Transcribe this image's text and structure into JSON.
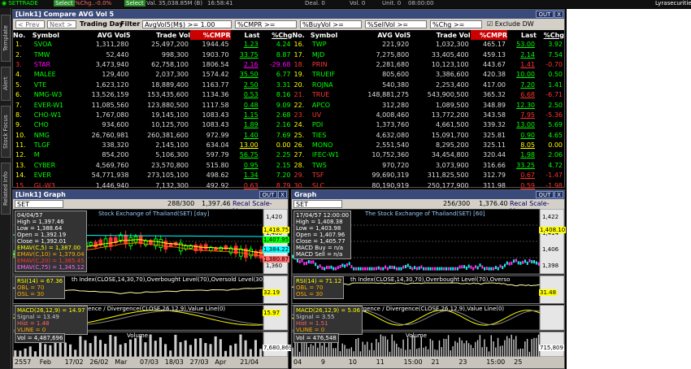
{
  "topbar": {
    "a": "Select",
    "b": "%Chg..-0.0%",
    "c": "Select",
    "d": "Val. 35,038.85M (B)",
    "e": "16:58:41",
    "f": "Deal. 0",
    "g": "Vol. 0",
    "h": "Unit. 0",
    "i": "08:00:00",
    "j": "Lyrasecurities"
  },
  "tabs": [
    "Template",
    "Alert",
    "Stock Focus",
    "Related Info"
  ],
  "quote": {
    "title": "[Link1] Compare AVG Vol 5",
    "out": "OUT",
    "x": "X",
    "prev": "< Prev",
    "next": "Next >",
    "day": "Trading Day",
    "filter": "Filter :",
    "f1": "AvgVol5(M$) >= 1.00",
    "f2": "%CMPR >=",
    "f3": "%BuyVol >=",
    "f4": "%SellVol >=",
    "f5": "%Chg >=",
    "excl": "Exclude DW",
    "headers": [
      "No.",
      "Symbol",
      "AVG Vol5",
      "Trade Vol",
      "%CMPR",
      "Last",
      "%Chg"
    ],
    "left": [
      [
        "1.",
        "SVOA",
        "1,311,280",
        "25,497,200",
        "1944.45",
        "1.23",
        "4.24",
        "up"
      ],
      [
        "2.",
        "TMW",
        "52,440",
        "998,300",
        "1903.70",
        "33.75",
        "8.87",
        "up"
      ],
      [
        "3.",
        "STAR",
        "3,473,940",
        "62,758,100",
        "1806.54",
        "2.16",
        "-29.68",
        "mg"
      ],
      [
        "4.",
        "MALEE",
        "129,400",
        "2,037,300",
        "1574.42",
        "35.50",
        "6.77",
        "up"
      ],
      [
        "5.",
        "VTE",
        "1,623,120",
        "18,889,400",
        "1163.77",
        "2.50",
        "3.31",
        "up"
      ],
      [
        "6.",
        "NMG-W3",
        "13,526,159",
        "153,435,600",
        "1134.36",
        "0.53",
        "8.16",
        "up"
      ],
      [
        "7.",
        "EVER-W1",
        "11,085,560",
        "123,880,500",
        "1117.58",
        "0.48",
        "9.09",
        "up"
      ],
      [
        "8.",
        "CHO-W1",
        "1,767,080",
        "19,145,100",
        "1083.43",
        "1.15",
        "2.68",
        "up"
      ],
      [
        "9.",
        "CHO",
        "934,600",
        "10,125,700",
        "1083.43",
        "1.89",
        "2.16",
        "up"
      ],
      [
        "10.",
        "NMG",
        "26,760,981",
        "260,381,600",
        "972.99",
        "1.40",
        "7.69",
        "up"
      ],
      [
        "11.",
        "TLGF",
        "338,320",
        "2,145,100",
        "634.04",
        "13.00",
        "0.00",
        "ye"
      ],
      [
        "12.",
        "M",
        "854,200",
        "5,106,300",
        "597.79",
        "56.75",
        "2.25",
        "up"
      ],
      [
        "13.",
        "CYBER",
        "4,569,760",
        "23,570,800",
        "515.80",
        "0.95",
        "2.15",
        "up"
      ],
      [
        "14.",
        "EVER",
        "54,771,938",
        "273,105,100",
        "498.62",
        "1.34",
        "7.20",
        "up"
      ],
      [
        "15.",
        "GL-W3",
        "1,446,940",
        "7,132,300",
        "492.92",
        "0.63",
        "8.79",
        "dn"
      ]
    ],
    "right": [
      [
        "16.",
        "TWP",
        "221,920",
        "1,032,300",
        "465.17",
        "53.00",
        "3.92",
        "up"
      ],
      [
        "17.",
        "MJD",
        "7,275,800",
        "33,405,400",
        "459.13",
        "2.14",
        "7.54",
        "up"
      ],
      [
        "18.",
        "PRIN",
        "2,281,680",
        "10,123,100",
        "443.67",
        "1.41",
        "-0.70",
        "dn"
      ],
      [
        "19.",
        "TRUEIF",
        "805,600",
        "3,386,600",
        "420.38",
        "10.00",
        "0.50",
        "up"
      ],
      [
        "20.",
        "ROJNA",
        "540,380",
        "2,253,400",
        "417.00",
        "7.20",
        "1.41",
        "up"
      ],
      [
        "21.",
        "TRUE",
        "148,881,275",
        "543,900,500",
        "365.32",
        "6.68",
        "-6.71",
        "dn"
      ],
      [
        "22.",
        "APCO",
        "312,280",
        "1,089,500",
        "348.89",
        "12.30",
        "2.50",
        "up"
      ],
      [
        "23.",
        "UV",
        "4,008,460",
        "13,772,200",
        "343.58",
        "7.95",
        "-5.36",
        "dn"
      ],
      [
        "24.",
        "PDI",
        "1,373,760",
        "4,661,500",
        "339.32",
        "13.00",
        "5.69",
        "up"
      ],
      [
        "25.",
        "TIES",
        "4,632,080",
        "15,091,700",
        "325.81",
        "0.90",
        "4.65",
        "up"
      ],
      [
        "26.",
        "MONO",
        "2,551,540",
        "8,295,200",
        "325.11",
        "8.05",
        "0.00",
        "ye"
      ],
      [
        "27.",
        "IFEC-W1",
        "10,752,360",
        "34,454,800",
        "320.44",
        "1.98",
        "2.06",
        "up"
      ],
      [
        "28.",
        "TWS",
        "970,720",
        "3,073,900",
        "316.66",
        "33.25",
        "4.72",
        "up"
      ],
      [
        "29.",
        "TSF",
        "99,690,319",
        "311,825,500",
        "312.79",
        "0.67",
        "-1.47",
        "dn"
      ],
      [
        "30.",
        "SLC",
        "80,190,919",
        "250,177,900",
        "311.98",
        "0.59",
        "-1.98",
        "dn"
      ]
    ]
  },
  "g1": {
    "title": "[Link1] Graph",
    "out": "OUT",
    "x": "X",
    "sym": "SET",
    "zoom": "288/300",
    "price": "1,397.46",
    "scale": "Recal Scale-Linear",
    "chartTitle": "Stock Exchange of Thailand(SET) [day]",
    "info": [
      "04/04/57",
      "High = 1,397.46",
      "Low = 1,388.64",
      "Open = 1,392.19",
      "Close = 1,392.01",
      "EMAV(C,5) = 1,387.00",
      "EMAV(C,10) = 1,379.04",
      "EMAV(C,20) = 1,365.45",
      "EMAV(C,75) = 1,345.12"
    ],
    "rsi": [
      "RSI(14) = 67.36",
      "OBL = 70",
      "OSL = 30"
    ],
    "rsiTitle": "th Index(CLOSE,14,30,70),Overbought Level(70),Oversold Level(30)",
    "macd": [
      "MACD(26,12,9) = 14.97",
      "Signal = 13.49",
      "Hist = 1.48",
      "VLINE = 0"
    ],
    "macdTitle": "nvergence / Divergence(CLOSE,26,12,9),Value Line(0)",
    "vol": "Vol = 4,487,696",
    "volTitle": "Volume",
    "yticks": [
      "1,420",
      "1,400",
      "1,380",
      "1,360"
    ],
    "tags": [
      "1,418.75",
      "1,407.95",
      "1,384.22",
      "1,380.87"
    ],
    "rsiTag": "32.19",
    "macdTag": "15.97",
    "volTag": "7,680,869",
    "dates": [
      "2557",
      "Feb",
      "17/02",
      "26/02",
      "Mar",
      "07/03",
      "18/03",
      "27/03",
      "Apr",
      "21/04"
    ],
    "bottom": [
      "FULL",
      "1 Y",
      "6 M",
      "3 M"
    ]
  },
  "g2": {
    "title": "Graph",
    "out": "OUT",
    "x": "X",
    "sym": "SET",
    "zoom": "256/300",
    "price": "1,376.40",
    "scale": "Recal Scale-Linear",
    "chartTitle": "The Stock Exchange of Thailand(SET) [60]",
    "info": [
      "17/04/57 12:00:00",
      "High = 1,408.38",
      "Low = 1,403.98",
      "Open = 1,407.96",
      "Close = 1,405.77",
      "MACD Buy = n/a",
      "MACD Sell = n/a"
    ],
    "rsi": [
      "RSI(14) = 71.12",
      "OBL = 70",
      "OSL = 30"
    ],
    "rsiTitle": "th Index(CLOSE,14,30,70),Overbought Level(70),Overso",
    "macd": [
      "MACD(26,12,9) = 5.06",
      "Signal = 3.55",
      "Hist = 1.51",
      "VLINE = 0"
    ],
    "macdTitle": "nvergence / Divergence(CLOSE,26,12,9),Value Line(0)",
    "vol": "Vol = 476,548",
    "volTitle": "Volume",
    "yticks": [
      "1,422",
      "1,414",
      "1,406",
      "1,398"
    ],
    "tags": [
      "1,408.10"
    ],
    "rsiTag": "31.48",
    "volTag": "715,809",
    "dates": [
      "04",
      "9",
      "10",
      "11",
      "15:00",
      "21",
      "23",
      "15:00",
      "25"
    ],
    "bottom": [
      "FULL",
      "1 M",
      "30 D",
      "3 D"
    ]
  }
}
